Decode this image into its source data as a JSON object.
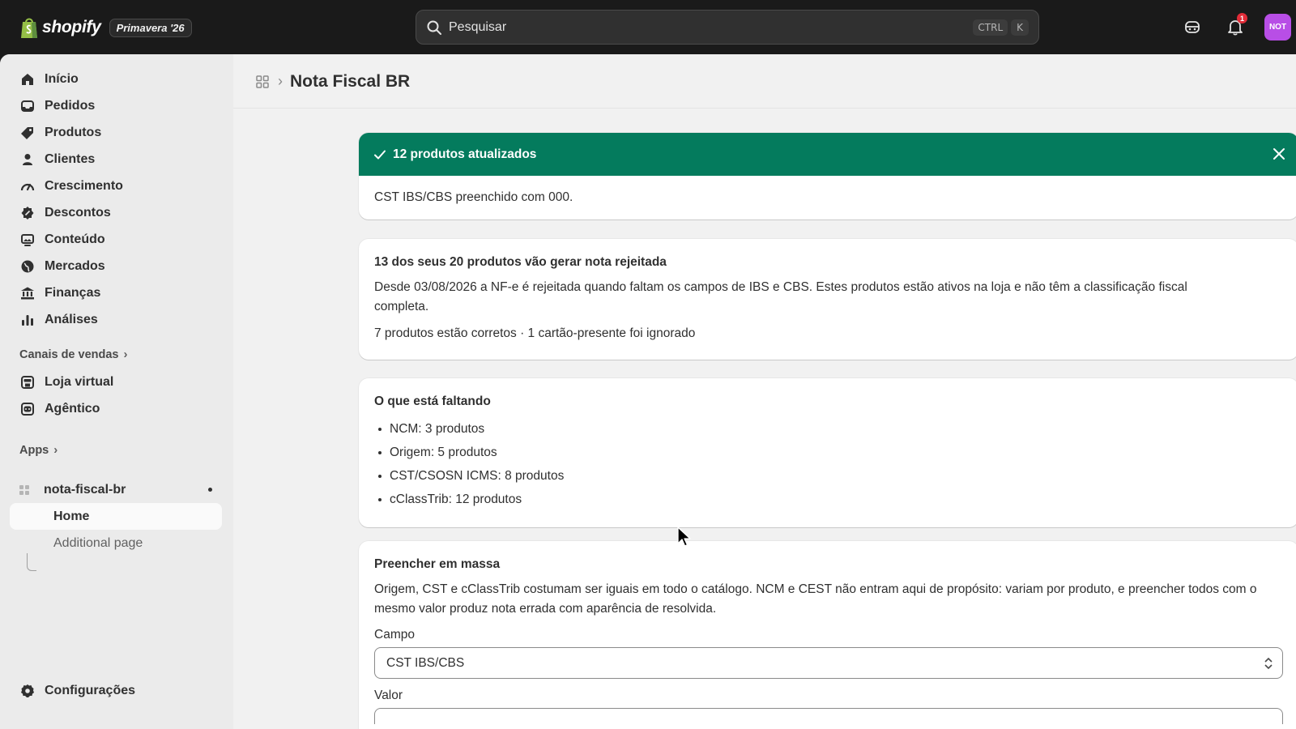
{
  "topbar": {
    "brand": "shopify",
    "edition": "Primavera '26",
    "search_placeholder": "Pesquisar",
    "shortcut_ctrl": "CTRL",
    "shortcut_k": "K",
    "notification_count": "1",
    "avatar_initials": "NOT"
  },
  "sidebar": {
    "items": [
      {
        "label": "Início",
        "icon": "home-icon"
      },
      {
        "label": "Pedidos",
        "icon": "inbox-icon"
      },
      {
        "label": "Produtos",
        "icon": "tag-icon"
      },
      {
        "label": "Clientes",
        "icon": "person-icon"
      },
      {
        "label": "Crescimento",
        "icon": "gauge-icon"
      },
      {
        "label": "Descontos",
        "icon": "discount-icon"
      },
      {
        "label": "Conteúdo",
        "icon": "image-icon"
      },
      {
        "label": "Mercados",
        "icon": "globe-icon"
      },
      {
        "label": "Finanças",
        "icon": "bank-icon"
      },
      {
        "label": "Análises",
        "icon": "bar-chart-icon"
      }
    ],
    "sales_channels_header": "Canais de vendas",
    "sales_channels": [
      {
        "label": "Loja virtual",
        "icon": "store-icon"
      },
      {
        "label": "Agêntico",
        "icon": "robot-icon"
      }
    ],
    "apps_header": "Apps",
    "app_name": "nota-fiscal-br",
    "app_pages": [
      "Home",
      "Additional page"
    ],
    "settings_label": "Configurações"
  },
  "page": {
    "title": "Nota Fiscal BR"
  },
  "banner": {
    "title": "12 produtos atualizados",
    "body": "CST IBS/CBS preenchido com 000.",
    "color": "#047b5d"
  },
  "summary_card": {
    "title": "13 dos seus 20 produtos vão gerar nota rejeitada",
    "body": "Desde 03/08/2026 a NF-e é rejeitada quando faltam os campos de IBS e CBS. Estes produtos estão ativos na loja e não têm a classificação fiscal completa.",
    "footer": "7 produtos estão corretos · 1 cartão-presente foi ignorado"
  },
  "missing_card": {
    "title": "O que está faltando",
    "items": [
      "NCM: 3 produtos",
      "Origem: 5 produtos",
      "CST/CSOSN ICMS: 8 produtos",
      "cClassTrib: 12 produtos"
    ]
  },
  "bulk_card": {
    "title": "Preencher em massa",
    "body": "Origem, CST e cClassTrib costumam ser iguais em todo o catálogo. NCM e CEST não entram aqui de propósito: variam por produto, e preencher todos com o mesmo valor produz nota errada com aparência de resolvida.",
    "field_label": "Campo",
    "field_value": "CST IBS/CBS",
    "value_label": "Valor"
  }
}
